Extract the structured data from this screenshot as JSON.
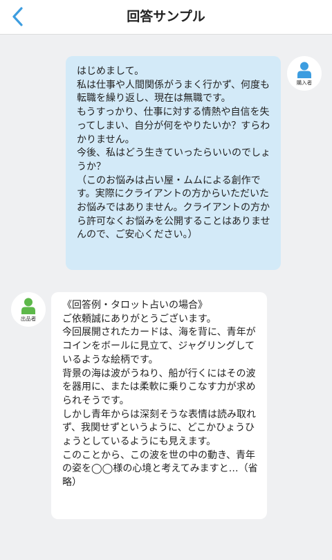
{
  "header": {
    "title": "回答サンプル",
    "back_icon": "chevron-left-icon",
    "accent_color": "#3d9de0"
  },
  "messages": [
    {
      "role_label": "購入者",
      "avatar_icon": "person-icon",
      "avatar_color": "#3d9de0",
      "bubble_color": "#d3eaf8",
      "text": "はじめまして。\n私は仕事や人間関係がうまく行かず、何度も転職を繰り返し、現在は無職です。\nもうすっかり、仕事に対する情熱や自信を失ってしまい、自分が何をやりたいか？すらわかりません。\n今後、私はどう生きていったらいいのでしょうか？\n（このお悩みは占い屋・ムムによる創作です。実際にクライアントの方からいただいたお悩みではありません。クライアントの方から許可なくお悩みを公開することはありませんので、ご安心ください。）"
    },
    {
      "role_label": "出品者",
      "avatar_icon": "person-icon",
      "avatar_color": "#5db84a",
      "bubble_color": "#ffffff",
      "text": "《回答例・タロット占いの場合》\nご依頼誠にありがとうございます。\n今回展開されたカードは、海を背に、青年がコインをボールに見立て、ジャグリングしているような絵柄です。\n背景の海は波がうねり、船が行くにはその波を器用に、または柔軟に乗りこなす力が求められそうです。\nしかし青年からは深刻そうな表情は読み取れず、我関せずというように、どこかひょうひょうとしているようにも見えます。\nこのことから、この波を世の中の動き、青年の姿を◯◯様の心境と考えてみますと…（省略）"
    }
  ]
}
